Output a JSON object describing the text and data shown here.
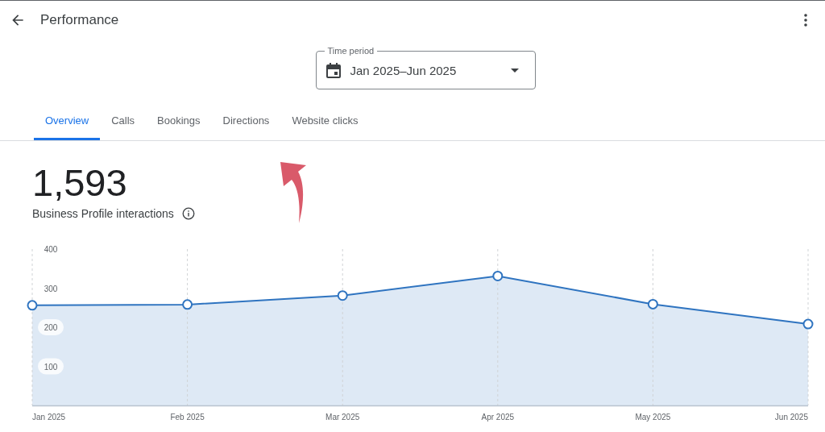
{
  "header": {
    "title": "Performance"
  },
  "time_period": {
    "label": "Time period",
    "value": "Jan 2025–Jun 2025"
  },
  "tabs": [
    {
      "label": "Overview",
      "selected": true
    },
    {
      "label": "Calls",
      "selected": false
    },
    {
      "label": "Bookings",
      "selected": false
    },
    {
      "label": "Directions",
      "selected": false
    },
    {
      "label": "Website clicks",
      "selected": false
    }
  ],
  "summary": {
    "value": "1,593",
    "label": "Business Profile interactions"
  },
  "chart_data": {
    "type": "area",
    "categories": [
      "Jan 2025",
      "Feb 2025",
      "Mar 2025",
      "Apr 2025",
      "May 2025",
      "Jun 2025"
    ],
    "ylim": [
      0,
      400
    ],
    "grid": true,
    "yticks": [
      100,
      200,
      300,
      400
    ],
    "series": [
      {
        "color": "#2f74c0",
        "values": [
          256,
          258,
          281,
          331,
          259,
          208
        ]
      }
    ]
  }
}
